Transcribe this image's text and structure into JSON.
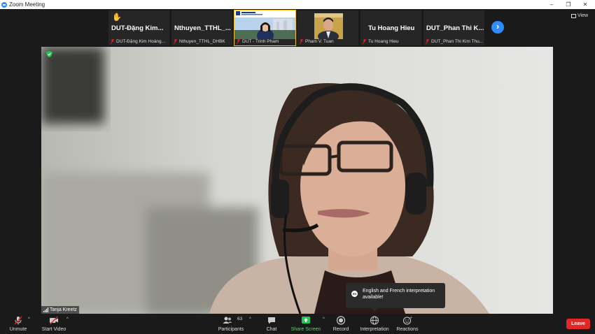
{
  "window": {
    "title": "Zoom Meeting",
    "controls": [
      "–",
      "❐",
      "✕"
    ]
  },
  "strip": {
    "tiles": [
      {
        "big_name": "DUT-Đặng  Kim...",
        "small_name": "DUT-Đặng Kim Hoàng...",
        "hand_raised": true,
        "muted": true
      },
      {
        "big_name": "Nthuyen_TTHL_...",
        "small_name": "Nthuyen_TTHL_DHBK",
        "muted": true
      },
      {
        "big_name": "",
        "small_name": "DUT - Trinh Pham",
        "has_video": true,
        "active": true,
        "muted": true
      },
      {
        "big_name": "",
        "small_name": "Pham V. Tuan",
        "has_video": true,
        "muted": true
      },
      {
        "big_name": "Tu Hoang Hieu",
        "small_name": "Tu Hoang Hieu",
        "muted": true
      },
      {
        "big_name": "DUT_Phan  Thi  K...",
        "small_name": "DUT_Phan Thi Kim Thu...",
        "muted": true
      }
    ],
    "next_label": "›",
    "view_label": "View"
  },
  "main": {
    "speaker_name": "Tanja Kreetz"
  },
  "toast": {
    "icon_text": "EN",
    "message": "English and French interpretation available!"
  },
  "toolbar": {
    "unmute": "Unmute",
    "start_video": "Start Video",
    "participants": "Participants",
    "participants_count": "63",
    "chat": "Chat",
    "share_screen": "Share Screen",
    "record": "Record",
    "interpretation": "Interpretation",
    "reactions": "Reactions",
    "leave": "Leave"
  },
  "colors": {
    "accent": "#2d8cff",
    "share_green": "#4cd964",
    "leave_red": "#e02828",
    "hand_yellow": "#f5c518"
  }
}
